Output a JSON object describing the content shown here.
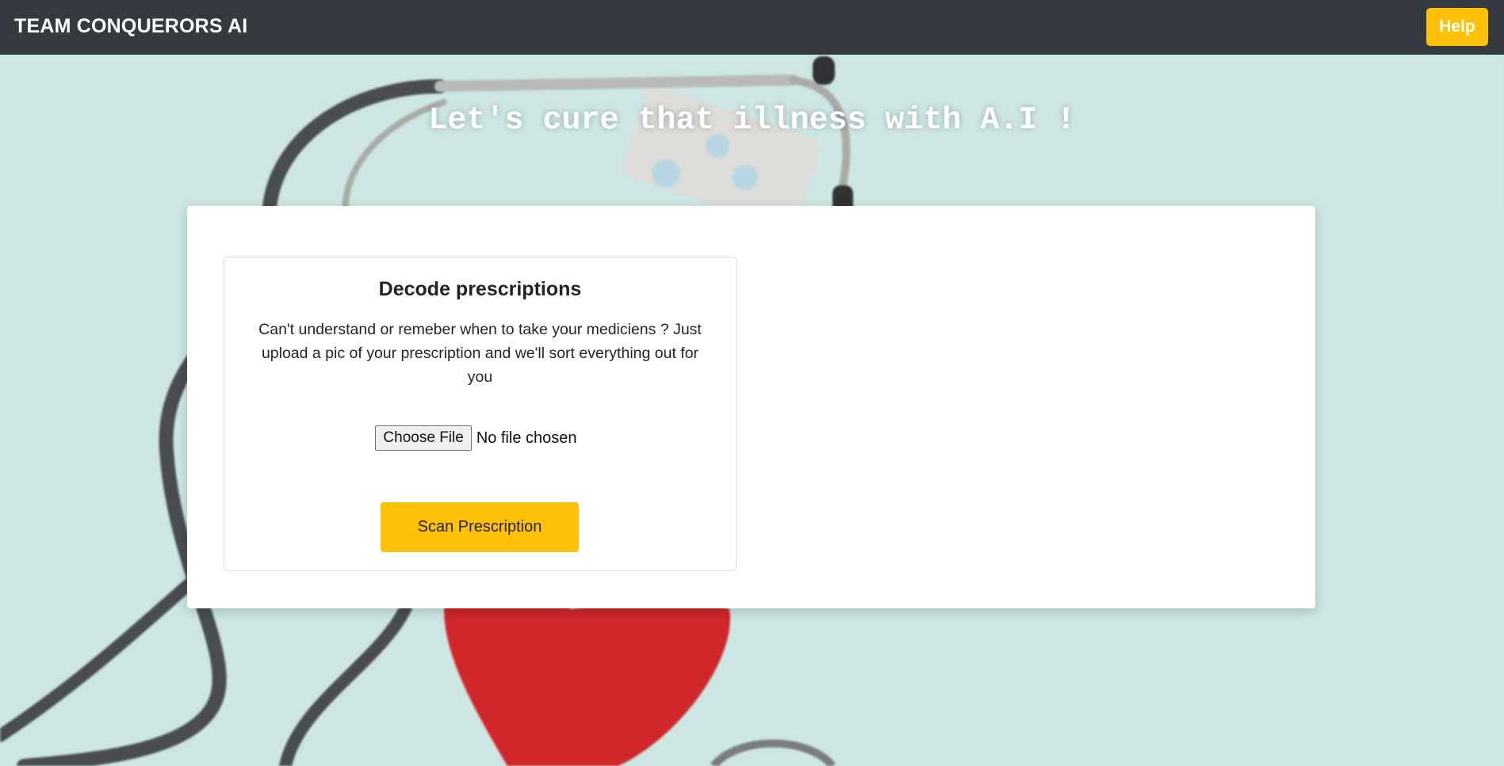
{
  "navbar": {
    "brand": "TEAM CONQUERORS AI",
    "help_label": "Help"
  },
  "hero": {
    "headline": "Let's cure that illness with A.I !"
  },
  "card": {
    "title": "Decode prescriptions",
    "description": "Can't understand or remeber when to take your mediciens ? Just upload a pic of your prescription and we'll sort everything out for you",
    "file_input": {
      "button_label": "Choose File",
      "status": "No file chosen"
    },
    "scan_label": "Scan Prescription"
  },
  "colors": {
    "navbar_bg": "#343a40",
    "accent_yellow": "#ffc107",
    "background_teal": "#cfe6e3",
    "panel_bg": "#ffffff"
  },
  "background_image": "stethoscope-pills-heart-photo"
}
